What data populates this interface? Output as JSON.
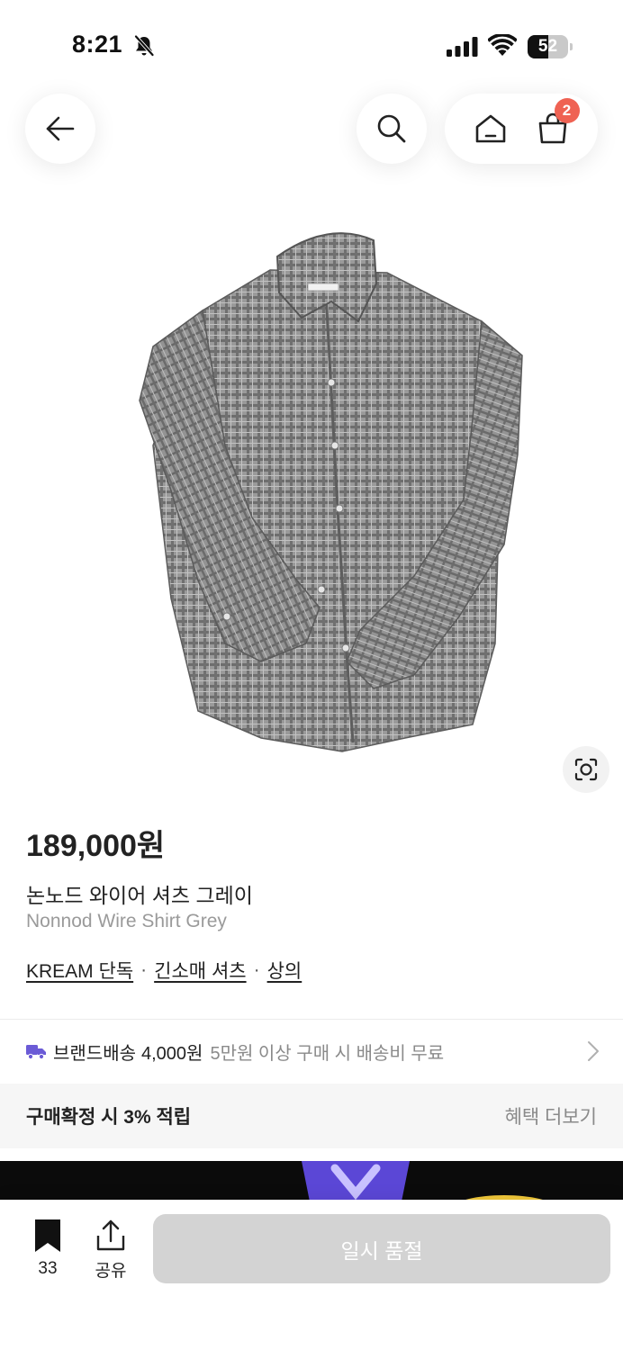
{
  "status_bar": {
    "time": "8:21",
    "battery": "52",
    "battery_level_percent": 52
  },
  "nav": {
    "cart_count": "2"
  },
  "product": {
    "price": "189,000원",
    "name_ko": "논노드 와이어 셔츠 그레이",
    "name_en": "Nonnod Wire Shirt Grey",
    "tags": [
      "KREAM 단독",
      "긴소매 셔츠",
      "상의"
    ],
    "tag_separator": "·"
  },
  "shipping": {
    "title": "브랜드배송",
    "price": "4,000원",
    "note": "5만원 이상 구매 시 배송비 무료"
  },
  "benefit": {
    "text": "구매확정 시 3% 적립",
    "more": "혜택 더보기"
  },
  "bottom": {
    "bookmark_count": "33",
    "share_label": "공유",
    "soldout_label": "일시 품절"
  },
  "colors": {
    "badge": "#ef6253",
    "shipping_icon": "#6b5bd6",
    "soldout_button": "#d3d3d3"
  },
  "icons": [
    "bell-slash-icon",
    "signal-icon",
    "wifi-icon",
    "back-arrow-icon",
    "search-icon",
    "home-icon",
    "cart-icon",
    "lens-icon",
    "truck-icon",
    "chevron-right-icon",
    "bookmark-icon",
    "share-icon"
  ]
}
